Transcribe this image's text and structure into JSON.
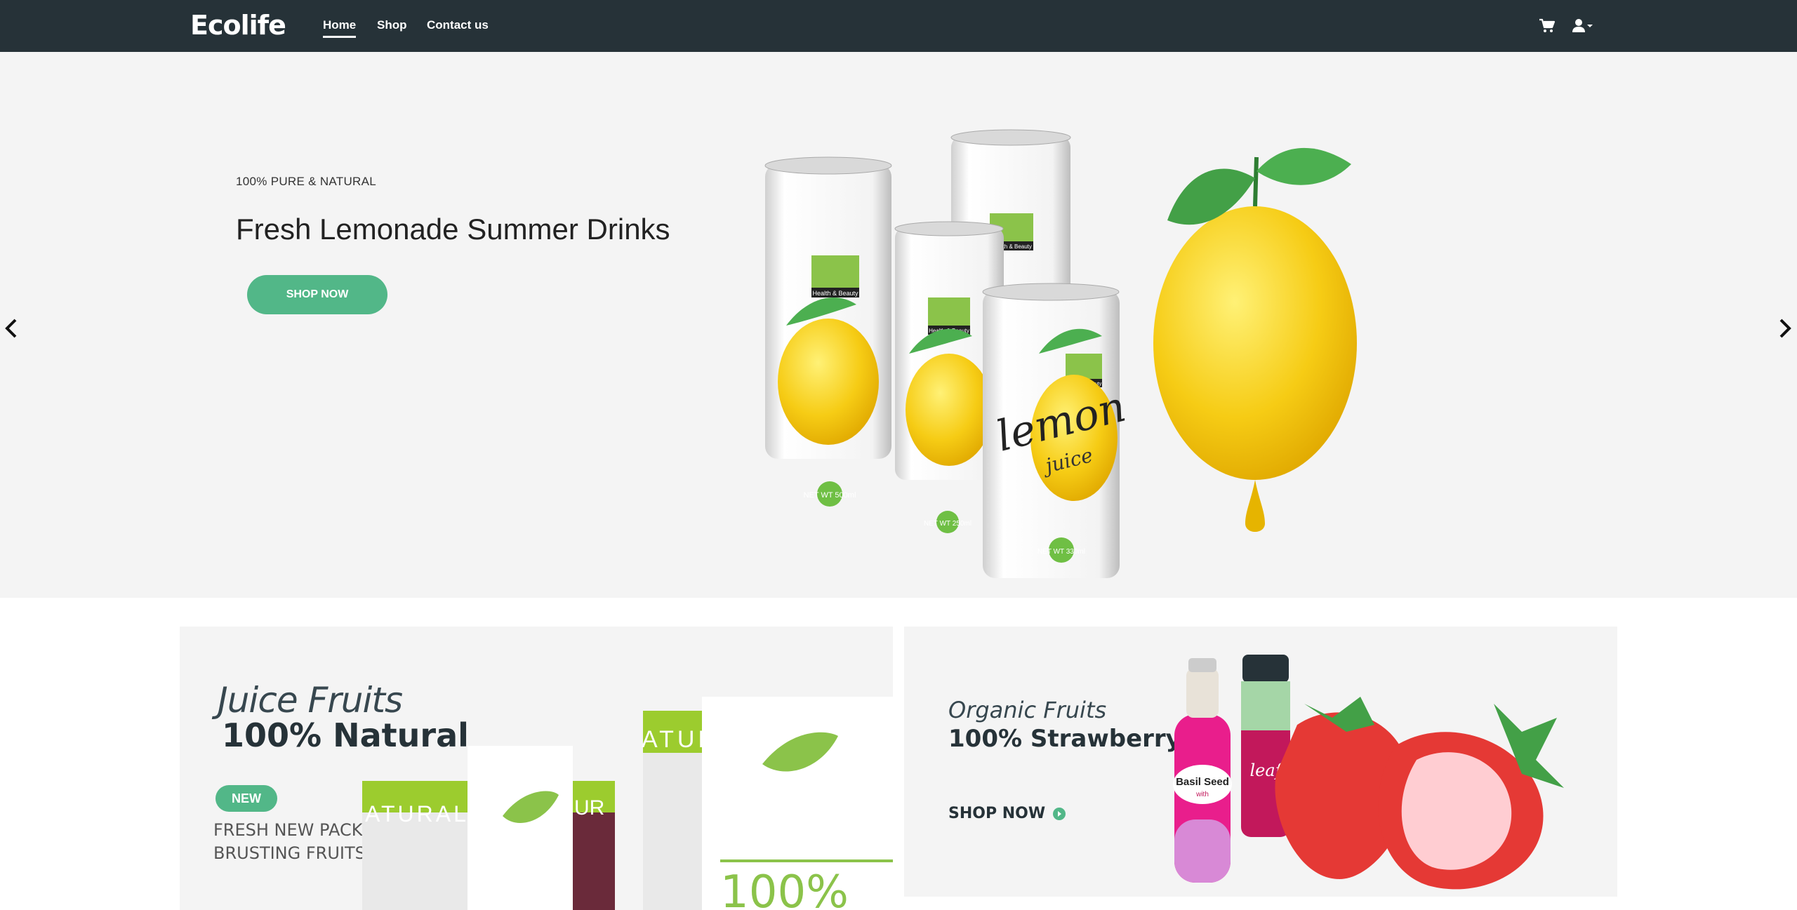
{
  "nav": {
    "logo": "Ecolife",
    "links": [
      {
        "label": "Home",
        "active": true
      },
      {
        "label": "Shop",
        "active": false
      },
      {
        "label": "Contact us",
        "active": false
      }
    ],
    "icons": [
      "cart-icon",
      "user-icon",
      "caret-down-icon"
    ]
  },
  "hero": {
    "eyebrow": "100% PURE & NATURAL",
    "title": "Fresh Lemonade Summer Drinks",
    "button": "SHOP NOW",
    "can_label": "Health & Beauty",
    "can_volumes": [
      "NET WT 500ml",
      "NET WT 250ml",
      "NET WT 330ml"
    ],
    "can_script": "lemon",
    "can_script_sub": "juice"
  },
  "banners": {
    "left": {
      "kicker": "Juice Fruits",
      "title": "100% Natural",
      "badge": "NEW",
      "description": "FRESH NEW PACK BRUSTING FRUITS",
      "jar_text": "ATURAL J",
      "jar_text_2": "UR",
      "jar_label": "100%"
    },
    "right": {
      "kicker": "Organic Fruits",
      "title": "100% Strawberry",
      "link": "SHOP NOW",
      "bottle1_label": "Basil Seed",
      "bottle1_sub": "with",
      "bottle2_label": "leaf"
    }
  },
  "colors": {
    "navbar": "#263238",
    "accent": "#52b788",
    "hero_bg": "#f4f4f4",
    "lemon": "#f4c90c",
    "leaf": "#3f9c2c",
    "strawberry": "#e53935"
  }
}
